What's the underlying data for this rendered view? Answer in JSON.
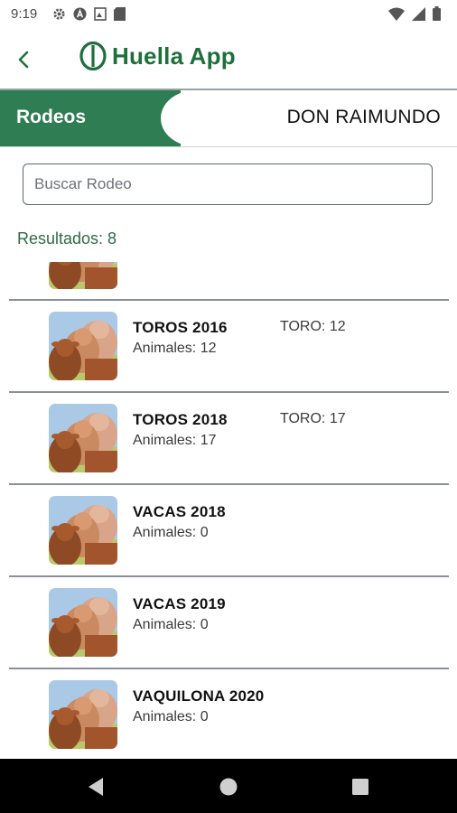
{
  "status_bar": {
    "time": "9:19",
    "left_icons": [
      "gear-icon",
      "app-a-icon",
      "image-icon",
      "sd-card-icon"
    ],
    "right_icons": [
      "wifi-icon",
      "signal-icon",
      "battery-icon"
    ]
  },
  "header": {
    "title": "Huella App",
    "brand_color": "#1f6f3c"
  },
  "band": {
    "section": "Rodeos",
    "establishment": "DON RAIMUNDO",
    "accent": "#2f7d52"
  },
  "search": {
    "placeholder": "Buscar Rodeo",
    "value": ""
  },
  "results_label": "Resultados: 8",
  "list": {
    "items": [
      {
        "title": "TOROS 2016",
        "count": "Animales: 12",
        "extra": "TORO: 12"
      },
      {
        "title": "TOROS 2018",
        "count": "Animales: 17",
        "extra": "TORO: 17"
      },
      {
        "title": "VACAS 2018",
        "count": "Animales: 0",
        "extra": ""
      },
      {
        "title": "VACAS 2019",
        "count": "Animales: 0",
        "extra": ""
      },
      {
        "title": "VAQUILONA 2020",
        "count": "Animales: 0",
        "extra": ""
      }
    ]
  },
  "nav": {
    "icons": [
      "back-nav-icon",
      "home-nav-icon",
      "recents-nav-icon"
    ]
  }
}
